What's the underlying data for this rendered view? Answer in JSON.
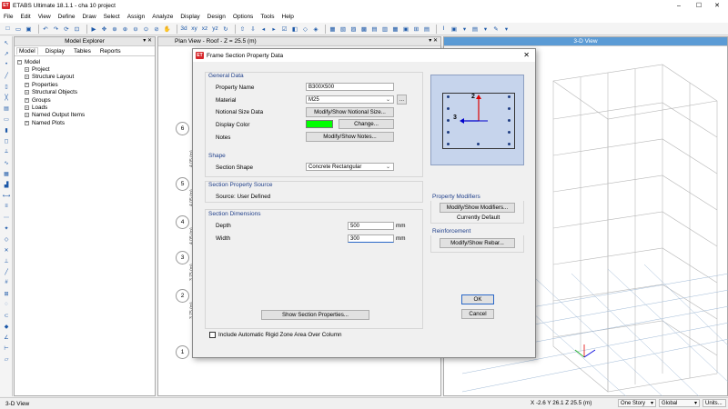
{
  "app": {
    "title": "ETABS Ultimate 18.1.1 - cha 10 project",
    "logo": "ET"
  },
  "menu": [
    "File",
    "Edit",
    "View",
    "Define",
    "Draw",
    "Select",
    "Assign",
    "Analyze",
    "Display",
    "Design",
    "Options",
    "Tools",
    "Help"
  ],
  "explorer": {
    "title": "Model Explorer",
    "tabs": [
      "Model",
      "Display",
      "Tables",
      "Reports"
    ],
    "root": "Model",
    "items": [
      "Project",
      "Structure Layout",
      "Properties",
      "Structural Objects",
      "Groups",
      "Loads",
      "Named Output Items",
      "Named Plots"
    ]
  },
  "planview": {
    "title": "Plan View - Roof - Z = 25.5 (m)",
    "grid_labels": [
      "6",
      "5",
      "4",
      "3",
      "2",
      "1"
    ],
    "dims": [
      "4.05 (m)",
      "4.05 (m)",
      "4.05 (m)",
      "3.75 (m)",
      "3.75 (m)"
    ]
  },
  "view3d": {
    "title": "3-D View"
  },
  "dialog": {
    "title": "Frame Section Property Data",
    "general": {
      "heading": "General Data",
      "property_name_label": "Property Name",
      "property_name": "B300X500",
      "material_label": "Material",
      "material": "M25",
      "notional_label": "Notional Size Data",
      "notional_button": "Modify/Show Notional Size...",
      "color_label": "Display Color",
      "color_button": "Change...",
      "color": "#00ff00",
      "notes_label": "Notes",
      "notes_button": "Modify/Show Notes...",
      "ellipsis": "..."
    },
    "shape": {
      "heading": "Shape",
      "label": "Section Shape",
      "value": "Concrete Rectangular"
    },
    "source": {
      "heading": "Section Property Source",
      "text": "Source:  User Defined"
    },
    "dimensions": {
      "heading": "Section Dimensions",
      "depth_label": "Depth",
      "depth": "500",
      "width_label": "Width",
      "width": "300",
      "unit": "mm"
    },
    "modifiers": {
      "heading": "Property Modifiers",
      "button": "Modify/Show Modifiers...",
      "status": "Currently Default"
    },
    "reinforcement": {
      "heading": "Reinforcement",
      "button": "Modify/Show Rebar..."
    },
    "ok": "OK",
    "cancel": "Cancel",
    "show_props": "Show Section Properties...",
    "rigid_zone": "Include Automatic Rigid Zone Area Over Column",
    "preview": {
      "axis2": "2",
      "axis3": "3"
    }
  },
  "status": {
    "view": "3-D View",
    "coords": "X -2.6  Y 26.1  Z 25.5 (m)",
    "story": "One Story",
    "system": "Global",
    "units": "Units..."
  }
}
